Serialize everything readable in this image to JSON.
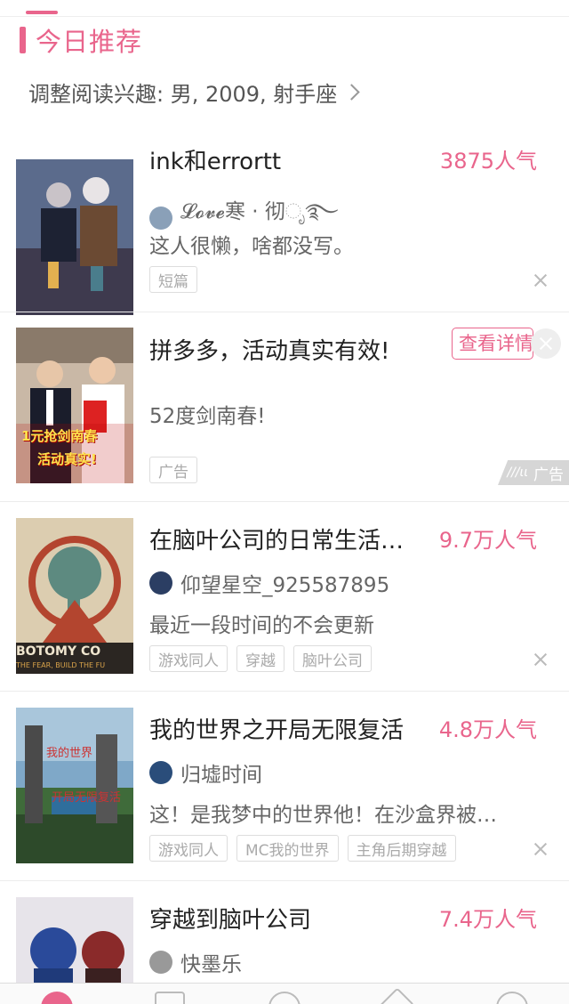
{
  "header": {
    "title": "今日推荐"
  },
  "interest": {
    "label": "调整阅读兴趣: 男, 2009, 射手座"
  },
  "books": [
    {
      "title": "ink和errortt",
      "popularity": "3875人气",
      "author": "𝓛𝓸𝓿𝓮寒 · 彻ೃ࿐",
      "desc": "这人很懒，啥都没写。",
      "tags": [
        "短篇"
      ]
    },
    {
      "title": "在脑叶公司的日常生活…",
      "popularity": "9.7万人气",
      "author": "仰望星空_925587895",
      "desc": "最近一段时间的不会更新",
      "tags": [
        "游戏同人",
        "穿越",
        "脑叶公司"
      ],
      "cover_text_1": "BOTOMY CO",
      "cover_text_2": "THE FEAR, BUILD THE FU"
    },
    {
      "title": "我的世界之开局无限复活",
      "popularity": "4.8万人气",
      "author": "归墟时间",
      "desc": "这！是我梦中的世界他！在沙盒界被…",
      "tags": [
        "游戏同人",
        "MC我的世界",
        "主角后期穿越"
      ],
      "cover_text_1": "我的世界",
      "cover_text_2": "开局无限复活"
    },
    {
      "title": "穿越到脑叶公司",
      "popularity": "7.4万人气",
      "author": "快墨乐"
    }
  ],
  "ad": {
    "title": "拼多多，活动真实有效!",
    "desc": "52度剑南春!",
    "tag": "广告",
    "button": "查看详情",
    "mark": "广告",
    "mark_logo": "///ιι",
    "cover_text_1": "1元抢剑南春",
    "cover_text_2": "活动真实!"
  },
  "colors": {
    "accent": "#e9658c"
  }
}
